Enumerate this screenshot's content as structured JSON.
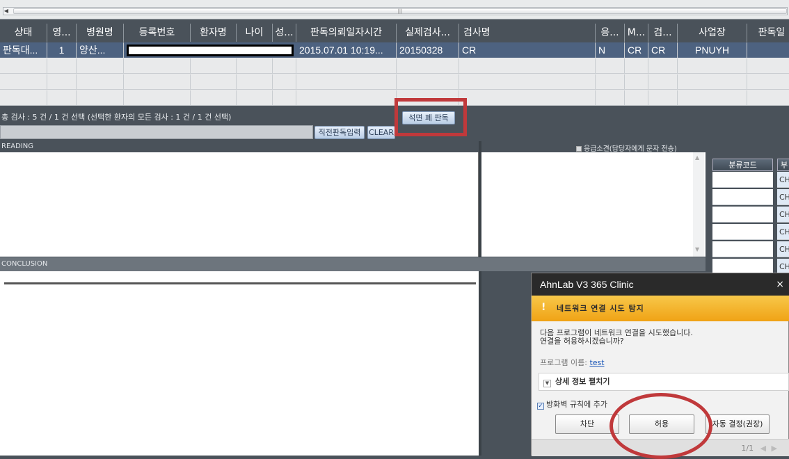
{
  "grid": {
    "headers": [
      "상태",
      "영...",
      "병원명",
      "등록번호",
      "환자명",
      "나이",
      "성...",
      "판독의뢰일자시간",
      "실제검사...",
      "검사명",
      "응...",
      "M...",
      "검...",
      "사업장",
      "판독일"
    ],
    "selected_row": [
      "판독대...",
      "1",
      "양산...",
      "",
      "",
      "",
      "",
      "2015.07.01 10:19...",
      "20150328",
      "CR",
      "N",
      "CR",
      "CR",
      "PNUYH",
      ""
    ]
  },
  "summary": "총 검사 : 5 건 / 1 건 선택 (선택한 환자의 모든 검사 : 1 건 / 1 건 선택)",
  "buttons": {
    "seokmyeon": "석면 폐 판독",
    "recent_reading": "직전판독입력",
    "clear": "CLEAR"
  },
  "reading": {
    "header": "READING",
    "urgent_label": "응급소견(담당자에게 문자 전송)"
  },
  "conclusion": {
    "header": "CONCLUSION"
  },
  "code_panel": {
    "header_code": "분류코드",
    "header_second": "부",
    "values": [
      "CH",
      "CH",
      "CH",
      "CH",
      "CH",
      "CH"
    ]
  },
  "v3_dialog": {
    "title": "AhnLab V3 365 Clinic",
    "close": "×",
    "warning": "네트워크 연결 시도 탐지",
    "message_line1": "다음 프로그램이 네트워크 연결을 시도했습니다.",
    "message_line2": "연결을 허용하시겠습니까?",
    "program_label": "프로그램 이름:",
    "program_name": "test",
    "details_toggle": "상세 정보 펼치기",
    "firewall_checkbox": "방화벽 규칙에 추가",
    "btn_block": "차단",
    "btn_allow": "허용",
    "btn_auto": "자동 결정(권장)",
    "page_indicator": "1/1",
    "page_prev": "◀",
    "page_next": "▶"
  },
  "colors": {
    "annotation_red": "#c0393b",
    "selected_row": "#4d6280",
    "warning_orange": "#f0a315"
  }
}
